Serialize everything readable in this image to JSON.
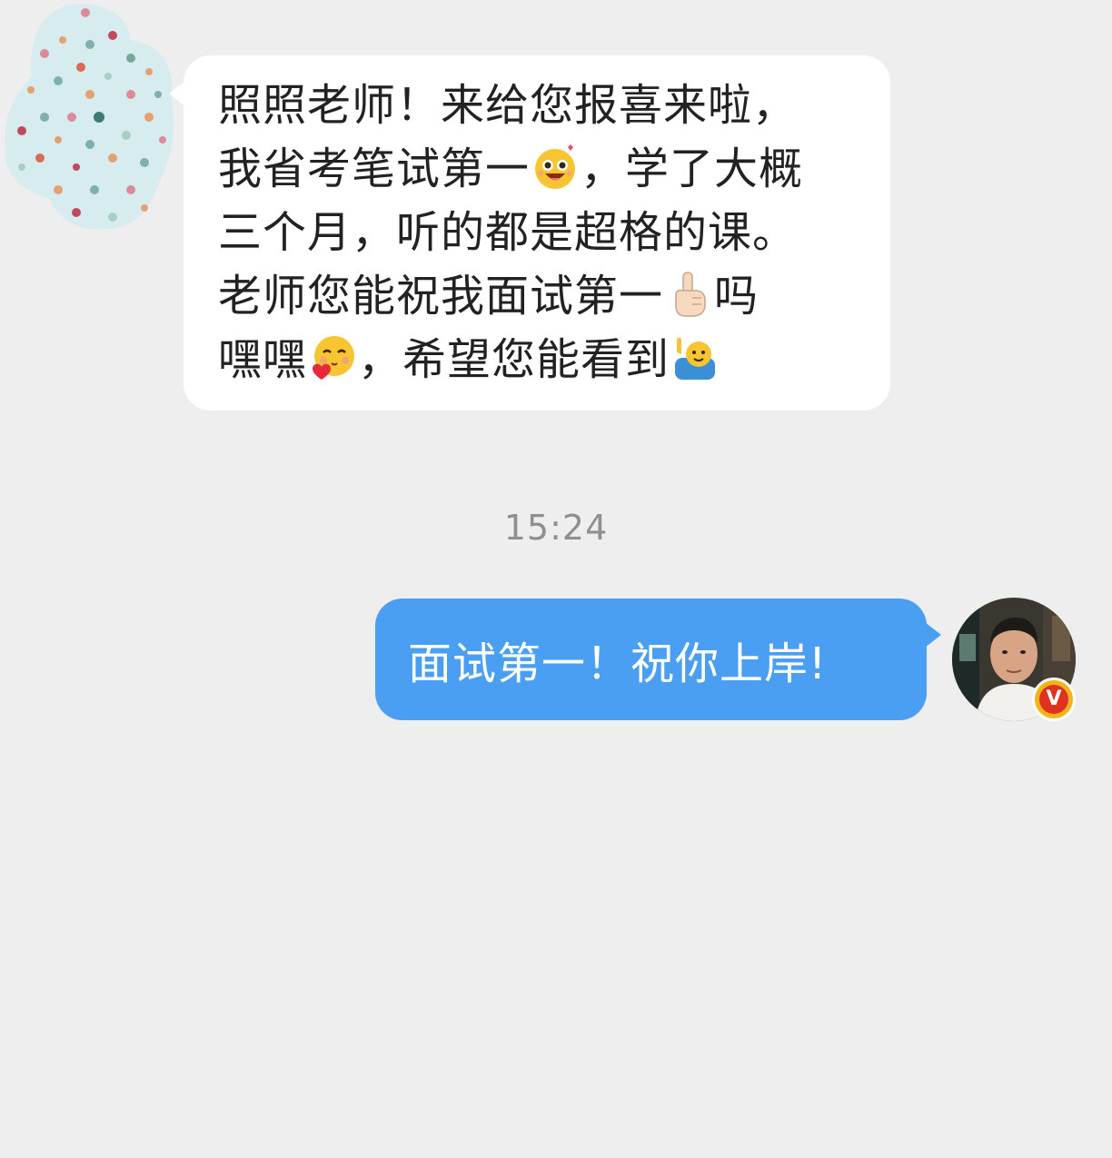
{
  "conversation": {
    "incoming": {
      "sender_avatar": "polka-dot-avatar",
      "lines": [
        {
          "parts": [
            {
              "text": "照照老师！来给您报喜来啦，"
            }
          ]
        },
        {
          "parts": [
            {
              "text": "我省考笔试第一"
            },
            {
              "emoji": "excited-face-emoji"
            },
            {
              "text": "，学了大概"
            }
          ]
        },
        {
          "parts": [
            {
              "text": "三个月，听的都是超格的课。"
            }
          ]
        },
        {
          "parts": [
            {
              "text": "老师您能祝我面试第一"
            },
            {
              "emoji": "index-pointing-up-emoji"
            },
            {
              "text": "吗"
            }
          ]
        },
        {
          "parts": [
            {
              "text": "嘿嘿"
            },
            {
              "emoji": "blushing-heart-face-emoji"
            },
            {
              "text": "，希望您能看到"
            },
            {
              "emoji": "raising-hand-emoji"
            }
          ]
        }
      ]
    },
    "timestamp": "15:24",
    "outgoing": {
      "text": "面试第一！祝你上岸!",
      "sender_avatar": "user-photo-avatar",
      "verified_badge": "V"
    }
  },
  "colors": {
    "background": "#eeeeee",
    "incoming_bubble": "#ffffff",
    "outgoing_bubble": "#4a9ff2",
    "timestamp": "#8f8f8f",
    "badge_outer": "#f3b31a",
    "badge_inner": "#e0321f"
  }
}
